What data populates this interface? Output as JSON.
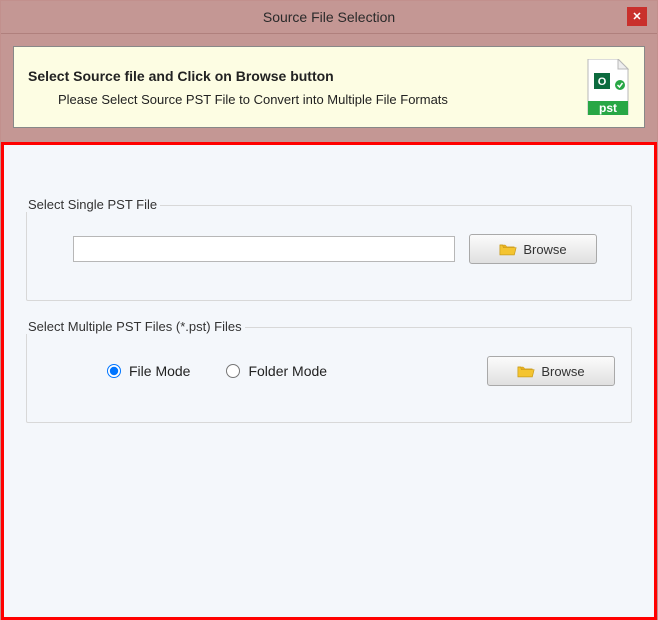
{
  "window": {
    "title": "Source File Selection",
    "close": "✕"
  },
  "info": {
    "heading": "Select Source file and Click on Browse button",
    "sub": "Please Select Source PST File to Convert into Multiple File Formats",
    "icon_badge": "pst"
  },
  "single": {
    "legend": "Select Single PST File",
    "value": "",
    "browse": "Browse"
  },
  "multiple": {
    "legend": "Select Multiple PST Files (*.pst) Files",
    "file_mode": "File Mode",
    "folder_mode": "Folder Mode",
    "browse": "Browse"
  }
}
